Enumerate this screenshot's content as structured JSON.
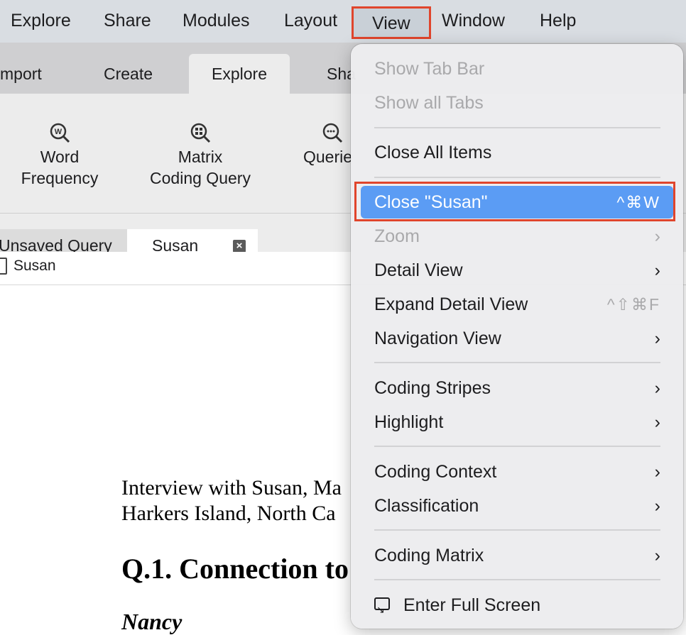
{
  "menubar": {
    "items": [
      "Explore",
      "Share",
      "Modules",
      "Layout",
      "View",
      "Window",
      "Help"
    ]
  },
  "ribbon_tabs": [
    "mport",
    "Create",
    "Explore",
    "Sha"
  ],
  "ribbon_buttons": {
    "word_frequency": "Word\nFrequency",
    "word_frequency_l1": "Word",
    "word_frequency_l2": "Frequency",
    "matrix_l1": "Matrix",
    "matrix_l2": "Coding Query",
    "queries": "Querie"
  },
  "doc_tabs": {
    "unsaved": "Unsaved Query",
    "susan": "Susan",
    "close_glyph": "×"
  },
  "doc_header": {
    "name": "Susan"
  },
  "document": {
    "line1": "Interview with Susan, Ma",
    "line2": "Harkers Island, North Ca",
    "heading": "Q.1. Connection to",
    "speaker": "Nancy"
  },
  "view_menu": {
    "show_tab_bar": "Show Tab Bar",
    "show_all_tabs": "Show all Tabs",
    "close_all_items": "Close All Items",
    "close_susan": "Close \"Susan\"",
    "close_susan_shortcut": "^⌘W",
    "zoom": "Zoom",
    "detail_view": "Detail View",
    "expand_detail_view": "Expand Detail View",
    "expand_detail_view_shortcut": "^⇧⌘F",
    "navigation_view": "Navigation View",
    "coding_stripes": "Coding Stripes",
    "highlight": "Highlight",
    "coding_context": "Coding Context",
    "classification": "Classification",
    "coding_matrix": "Coding Matrix",
    "enter_full_screen": "Enter Full Screen",
    "arrow": "›"
  },
  "colors": {
    "highlight": "#5b9cf4",
    "annotation_outline": "#e0452c"
  }
}
